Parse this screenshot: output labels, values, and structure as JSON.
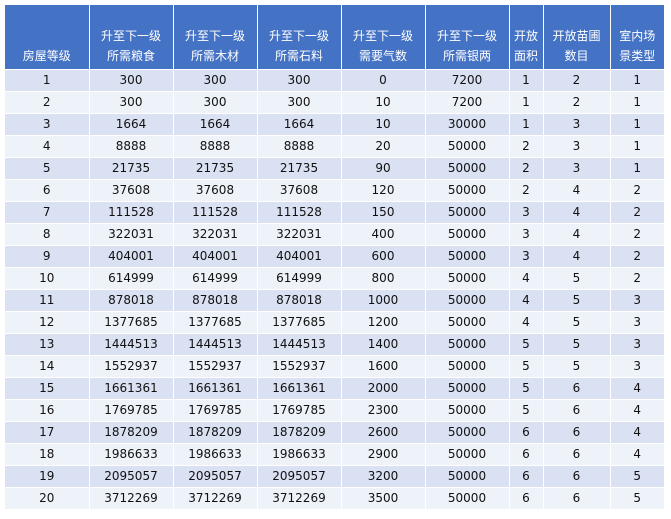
{
  "table": {
    "headers": [
      [
        "房屋等级"
      ],
      [
        "升至下一级",
        "所需粮食"
      ],
      [
        "升至下一级",
        "所需木材"
      ],
      [
        "升至下一级",
        "所需石料"
      ],
      [
        "升至下一级",
        "需要气数"
      ],
      [
        "升至下一级",
        "所需银两"
      ],
      [
        "开放",
        "面积"
      ],
      [
        "开放苗圃",
        "数目"
      ],
      [
        "室内场",
        "景类型"
      ]
    ],
    "rows": [
      [
        "1",
        "300",
        "300",
        "300",
        "0",
        "7200",
        "1",
        "2",
        "1"
      ],
      [
        "2",
        "300",
        "300",
        "300",
        "10",
        "7200",
        "1",
        "2",
        "1"
      ],
      [
        "3",
        "1664",
        "1664",
        "1664",
        "10",
        "30000",
        "1",
        "3",
        "1"
      ],
      [
        "4",
        "8888",
        "8888",
        "8888",
        "20",
        "50000",
        "2",
        "3",
        "1"
      ],
      [
        "5",
        "21735",
        "21735",
        "21735",
        "90",
        "50000",
        "2",
        "3",
        "1"
      ],
      [
        "6",
        "37608",
        "37608",
        "37608",
        "120",
        "50000",
        "2",
        "4",
        "2"
      ],
      [
        "7",
        "111528",
        "111528",
        "111528",
        "150",
        "50000",
        "3",
        "4",
        "2"
      ],
      [
        "8",
        "322031",
        "322031",
        "322031",
        "400",
        "50000",
        "3",
        "4",
        "2"
      ],
      [
        "9",
        "404001",
        "404001",
        "404001",
        "600",
        "50000",
        "3",
        "4",
        "2"
      ],
      [
        "10",
        "614999",
        "614999",
        "614999",
        "800",
        "50000",
        "4",
        "5",
        "2"
      ],
      [
        "11",
        "878018",
        "878018",
        "878018",
        "1000",
        "50000",
        "4",
        "5",
        "3"
      ],
      [
        "12",
        "1377685",
        "1377685",
        "1377685",
        "1200",
        "50000",
        "4",
        "5",
        "3"
      ],
      [
        "13",
        "1444513",
        "1444513",
        "1444513",
        "1400",
        "50000",
        "5",
        "5",
        "3"
      ],
      [
        "14",
        "1552937",
        "1552937",
        "1552937",
        "1600",
        "50000",
        "5",
        "5",
        "3"
      ],
      [
        "15",
        "1661361",
        "1661361",
        "1661361",
        "2000",
        "50000",
        "5",
        "6",
        "4"
      ],
      [
        "16",
        "1769785",
        "1769785",
        "1769785",
        "2300",
        "50000",
        "5",
        "6",
        "4"
      ],
      [
        "17",
        "1878209",
        "1878209",
        "1878209",
        "2600",
        "50000",
        "6",
        "6",
        "4"
      ],
      [
        "18",
        "1986633",
        "1986633",
        "1986633",
        "2900",
        "50000",
        "6",
        "6",
        "4"
      ],
      [
        "19",
        "2095057",
        "2095057",
        "2095057",
        "3200",
        "50000",
        "6",
        "6",
        "5"
      ],
      [
        "20",
        "3712269",
        "3712269",
        "3712269",
        "3500",
        "50000",
        "6",
        "6",
        "5"
      ]
    ]
  },
  "colors": {
    "header_bg": "#4472c4",
    "header_text": "#ffffff",
    "row_odd": "#d9e1f2",
    "row_even": "#eef2f9"
  }
}
